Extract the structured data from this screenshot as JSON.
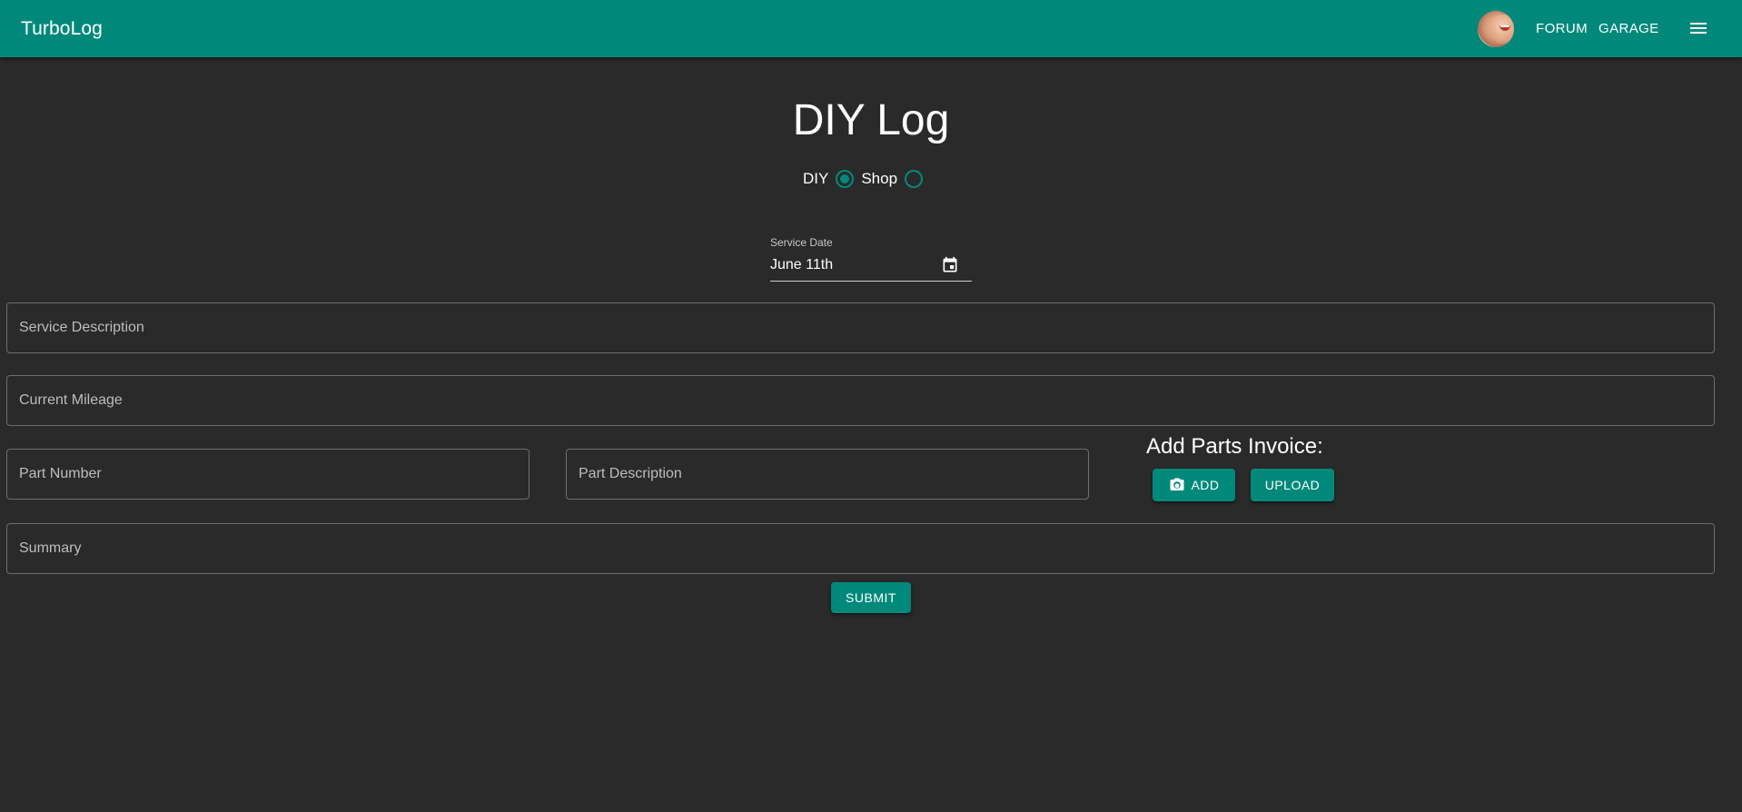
{
  "appbar": {
    "brand": "TurboLog",
    "nav": {
      "forum": "FORUM",
      "garage": "GARAGE"
    },
    "accent_color": "#00897b"
  },
  "page": {
    "title": "DIY Log",
    "radio": {
      "options": [
        {
          "label": "DIY",
          "checked": true
        },
        {
          "label": "Shop",
          "checked": false
        }
      ]
    },
    "service_date": {
      "label": "Service Date",
      "value": "June 11th"
    },
    "fields": {
      "service_description": {
        "placeholder": "Service Description"
      },
      "current_mileage": {
        "placeholder": "Current Mileage"
      },
      "part_number": {
        "placeholder": "Part Number"
      },
      "part_description": {
        "placeholder": "Part Description"
      },
      "summary": {
        "placeholder": "Summary"
      }
    },
    "invoice": {
      "title": "Add Parts Invoice:",
      "add_label": "ADD",
      "upload_label": "UPLOAD"
    },
    "submit_label": "SUBMIT"
  },
  "icons": [
    "avatar",
    "menu-icon",
    "calendar-icon",
    "camera-icon"
  ]
}
